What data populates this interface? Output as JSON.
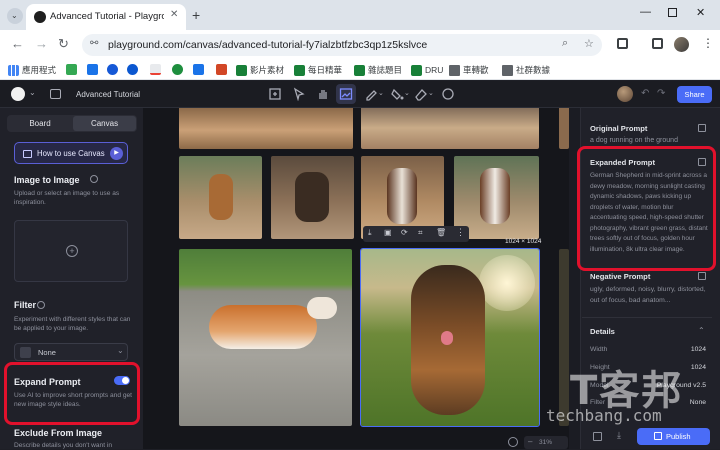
{
  "browser": {
    "tab_title": "Advanced Tutorial - Playground",
    "url": "playground.com/canvas/advanced-tutorial-fy7ialzbtfzbc3qp1z5kslvce",
    "bookmarks": [
      "應用程式",
      "影片素材",
      "每日精華",
      "雜誌題目",
      "DRU",
      "車轉歡",
      "社群數據"
    ]
  },
  "app": {
    "project_title": "Advanced Tutorial",
    "share_label": "Share",
    "publish_label": "Publish"
  },
  "left_panel": {
    "tabs": [
      "Board",
      "Canvas"
    ],
    "active_tab": "Canvas",
    "how_to_label": "How to use Canvas",
    "image_to_image": {
      "title": "Image to Image",
      "desc": "Upload or select an image to use as inspiration."
    },
    "filter": {
      "title": "Filter",
      "desc": "Experiment with different styles that can be applied to your image.",
      "selected": "None"
    },
    "expand_prompt": {
      "title": "Expand Prompt",
      "desc": "Use AI to improve short prompts and get new image style ideas.",
      "enabled": true
    },
    "exclude": {
      "title": "Exclude From Image",
      "desc": "Describe details you don't want in"
    }
  },
  "canvas": {
    "size_badge": "1024 × 1024",
    "zoom": "31%"
  },
  "right_panel": {
    "original_prompt_title": "Original Prompt",
    "original_prompt": "a dog running on the ground",
    "expanded_prompt_title": "Expanded Prompt",
    "expanded_prompt": "German Shepherd in mid-sprint across a dewy meadow, morning sunlight casting dynamic shadows, paws kicking up droplets of water, motion blur accentuating speed, high-speed shutter photography, vibrant green grass, distant trees softly out of focus, golden hour illumination, 8k ultra clear image.",
    "negative_prompt_title": "Negative Prompt",
    "negative_prompt": "ugly, deformed, noisy, blurry, distorted, out of focus, bad anatom...",
    "details_title": "Details",
    "details": [
      {
        "label": "Width",
        "value": "1024"
      },
      {
        "label": "Height",
        "value": "1024"
      },
      {
        "label": "Model",
        "value": "Playground v2.5"
      },
      {
        "label": "Filter",
        "value": "None"
      }
    ]
  },
  "watermark": {
    "brand": "T客邦",
    "site": "techbang.com"
  },
  "colors": {
    "accent": "#4a6cf7",
    "highlight": "#e1112c",
    "panel": "#202129",
    "canvas": "#15161b"
  }
}
